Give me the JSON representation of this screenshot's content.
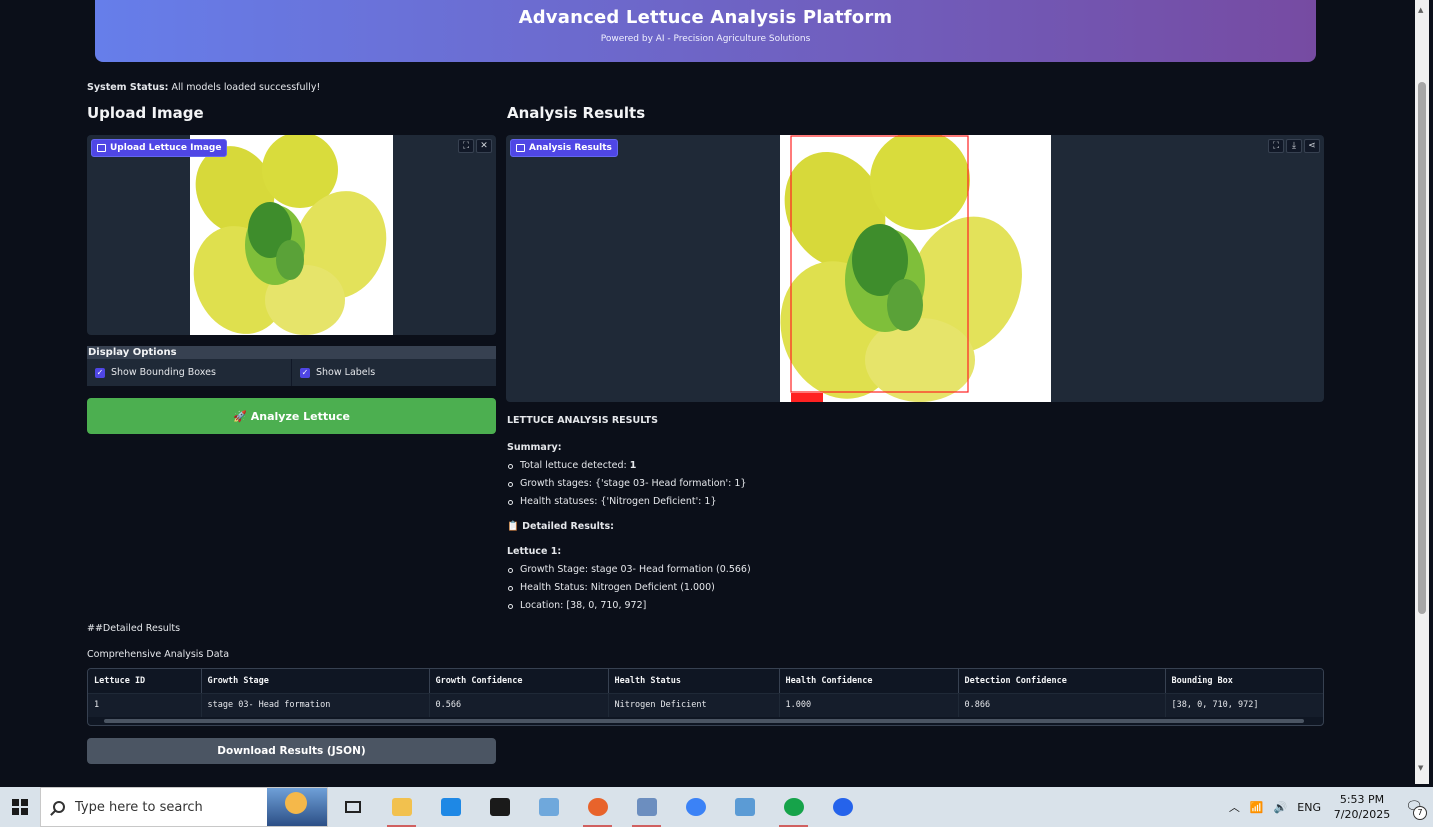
{
  "header": {
    "title": "Advanced Lettuce Analysis Platform",
    "subtitle": "Powered by AI - Precision Agriculture Solutions"
  },
  "status": {
    "label": "System Status:",
    "message": "All models loaded successfully!"
  },
  "upload": {
    "section_title": "Upload Image",
    "chip_label": "Upload Lettuce Image",
    "tools": [
      "fullscreen-icon",
      "close-icon"
    ]
  },
  "options": {
    "label": "Display Options",
    "show_boxes": {
      "label": "Show Bounding Boxes",
      "checked": true
    },
    "show_labels": {
      "label": "Show Labels",
      "checked": true
    }
  },
  "analyze_button": {
    "icon": "🚀",
    "label": "Analyze Lettuce"
  },
  "results": {
    "section_title": "Analysis Results",
    "chip_label": "Analysis Results",
    "tools": [
      "fullscreen-icon",
      "download-icon",
      "share-icon"
    ],
    "heading": "LETTUCE ANALYSIS RESULTS",
    "summary_label": "Summary:",
    "summary": {
      "total_label": "Total lettuce detected:",
      "total_value": "1",
      "growth": "Growth stages: {'stage 03- Head formation': 1}",
      "health": "Health statuses: {'Nitrogen Deficient': 1}"
    },
    "detailed_label": "📋 Detailed Results:",
    "lettuce_label": "Lettuce 1:",
    "lettuce_items": [
      "Growth Stage: stage 03- Head formation (0.566)",
      "Health Status: Nitrogen Deficient (1.000)",
      "Location: [38, 0, 710, 972]"
    ]
  },
  "detailed_heading": "##Detailed Results",
  "comprehensive_label": "Comprehensive Analysis Data",
  "table": {
    "columns": [
      "Lettuce ID",
      "Growth Stage",
      "Growth Confidence",
      "Health Status",
      "Health Confidence",
      "Detection Confidence",
      "Bounding Box"
    ],
    "rows": [
      [
        "1",
        "stage 03- Head formation",
        "0.566",
        "Nitrogen Deficient",
        "1.000",
        "0.866",
        "[38, 0, 710, 972]"
      ]
    ]
  },
  "download_button": {
    "label": "Download Results (JSON)"
  },
  "taskbar": {
    "search_placeholder": "Type here to search",
    "tray_lang": "ENG",
    "time": "5:53 PM",
    "date": "7/20/2025",
    "notifications": "7"
  },
  "colors": {
    "accent": "#4f46e5",
    "analyze": "#4caf50",
    "header_start": "#667eea",
    "header_end": "#764ba2",
    "bbox": "#ff2222"
  }
}
